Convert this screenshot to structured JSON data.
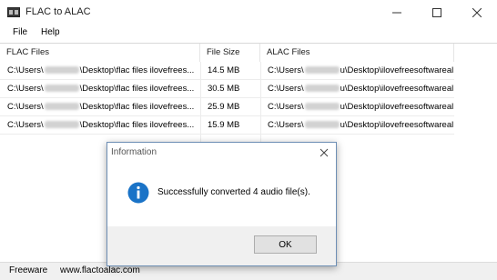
{
  "window": {
    "title": "FLAC to ALAC"
  },
  "menu": {
    "items": [
      "File",
      "Help"
    ]
  },
  "list": {
    "columns": [
      "FLAC Files",
      "File Size",
      "ALAC Files"
    ],
    "rows": [
      {
        "flac_prefix": "C:\\Users\\",
        "flac_suffix": "\\Desktop\\flac files ilovefrees...",
        "size": "14.5 MB",
        "alac_prefix": "C:\\Users\\",
        "alac_suffix": "u\\Desktop\\ilovefreesoftwareal..."
      },
      {
        "flac_prefix": "C:\\Users\\",
        "flac_suffix": "\\Desktop\\flac files ilovefrees...",
        "size": "30.5 MB",
        "alac_prefix": "C:\\Users\\",
        "alac_suffix": "u\\Desktop\\ilovefreesoftwareal..."
      },
      {
        "flac_prefix": "C:\\Users\\",
        "flac_suffix": "\\Desktop\\flac files ilovefrees...",
        "size": "25.9 MB",
        "alac_prefix": "C:\\Users\\",
        "alac_suffix": "u\\Desktop\\ilovefreesoftwareal..."
      },
      {
        "flac_prefix": "C:\\Users\\",
        "flac_suffix": "\\Desktop\\flac files ilovefrees...",
        "size": "15.9 MB",
        "alac_prefix": "C:\\Users\\",
        "alac_suffix": "u\\Desktop\\ilovefreesoftwareal..."
      }
    ]
  },
  "status": {
    "left": "Freeware",
    "right": "www.flactoalac.com"
  },
  "dialog": {
    "title": "Information",
    "message": "Successfully converted 4 audio file(s).",
    "ok_label": "OK",
    "icon": "info-icon"
  },
  "colors": {
    "info_blue": "#1a73c7",
    "dialog_border": "#6e8fb5"
  }
}
